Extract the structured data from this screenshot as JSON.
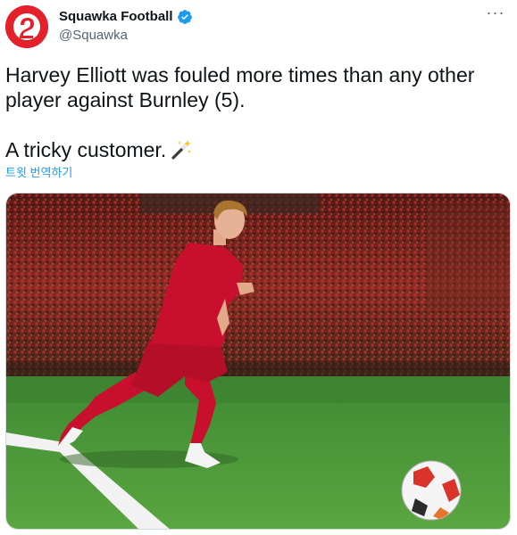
{
  "author": {
    "name": "Squawka Football",
    "handle": "@Squawka",
    "verified": true,
    "avatar_icon": "squawka-logo-icon",
    "brand_color": "#e4202b"
  },
  "menu": {
    "icon": "more-options-icon",
    "label": "···"
  },
  "tweet": {
    "line1": "Harvey Elliott was fouled more times than any other player against Burnley (5).",
    "line2": "A tricky customer.",
    "emoji_icon": "magic-wand-icon",
    "translate_label": "트윗 번역하기"
  },
  "media": {
    "description_icon": "football-player-photo",
    "kit_color": "#c8102e",
    "pitch_color": "#4f9a3a"
  }
}
